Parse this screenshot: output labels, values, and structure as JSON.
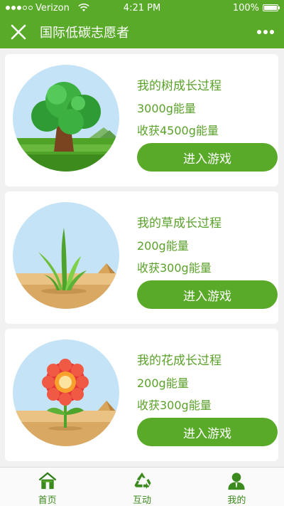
{
  "status_bar": {
    "carrier": "Verizon",
    "time": "4:21 PM",
    "battery": "100%",
    "battery_level": 1.0
  },
  "header": {
    "title": "国际低碳志愿者",
    "close_icon": "close-icon",
    "more_icon": "more-icon"
  },
  "cards": [
    {
      "title": "我的树成长过程",
      "energy": "3000g能量",
      "harvest": "收获4500g能量",
      "button": "进入游戏",
      "illustration": "tree"
    },
    {
      "title": "我的草成长过程",
      "energy": "200g能量",
      "harvest": "收获300g能量",
      "button": "进入游戏",
      "illustration": "grass"
    },
    {
      "title": "我的花成长过程",
      "energy": "200g能量",
      "harvest": "收获300g能量",
      "button": "进入游戏",
      "illustration": "flower"
    }
  ],
  "tabbar": {
    "tabs": [
      {
        "label": "首页",
        "icon": "home-icon"
      },
      {
        "label": "互动",
        "icon": "recycle-icon"
      },
      {
        "label": "我的",
        "icon": "user-icon"
      }
    ]
  },
  "colors": {
    "brand_green": "#5aaa2a",
    "text_green": "#5aa12a",
    "tab_green": "#3b8a1d",
    "background": "#f1f1f1"
  }
}
